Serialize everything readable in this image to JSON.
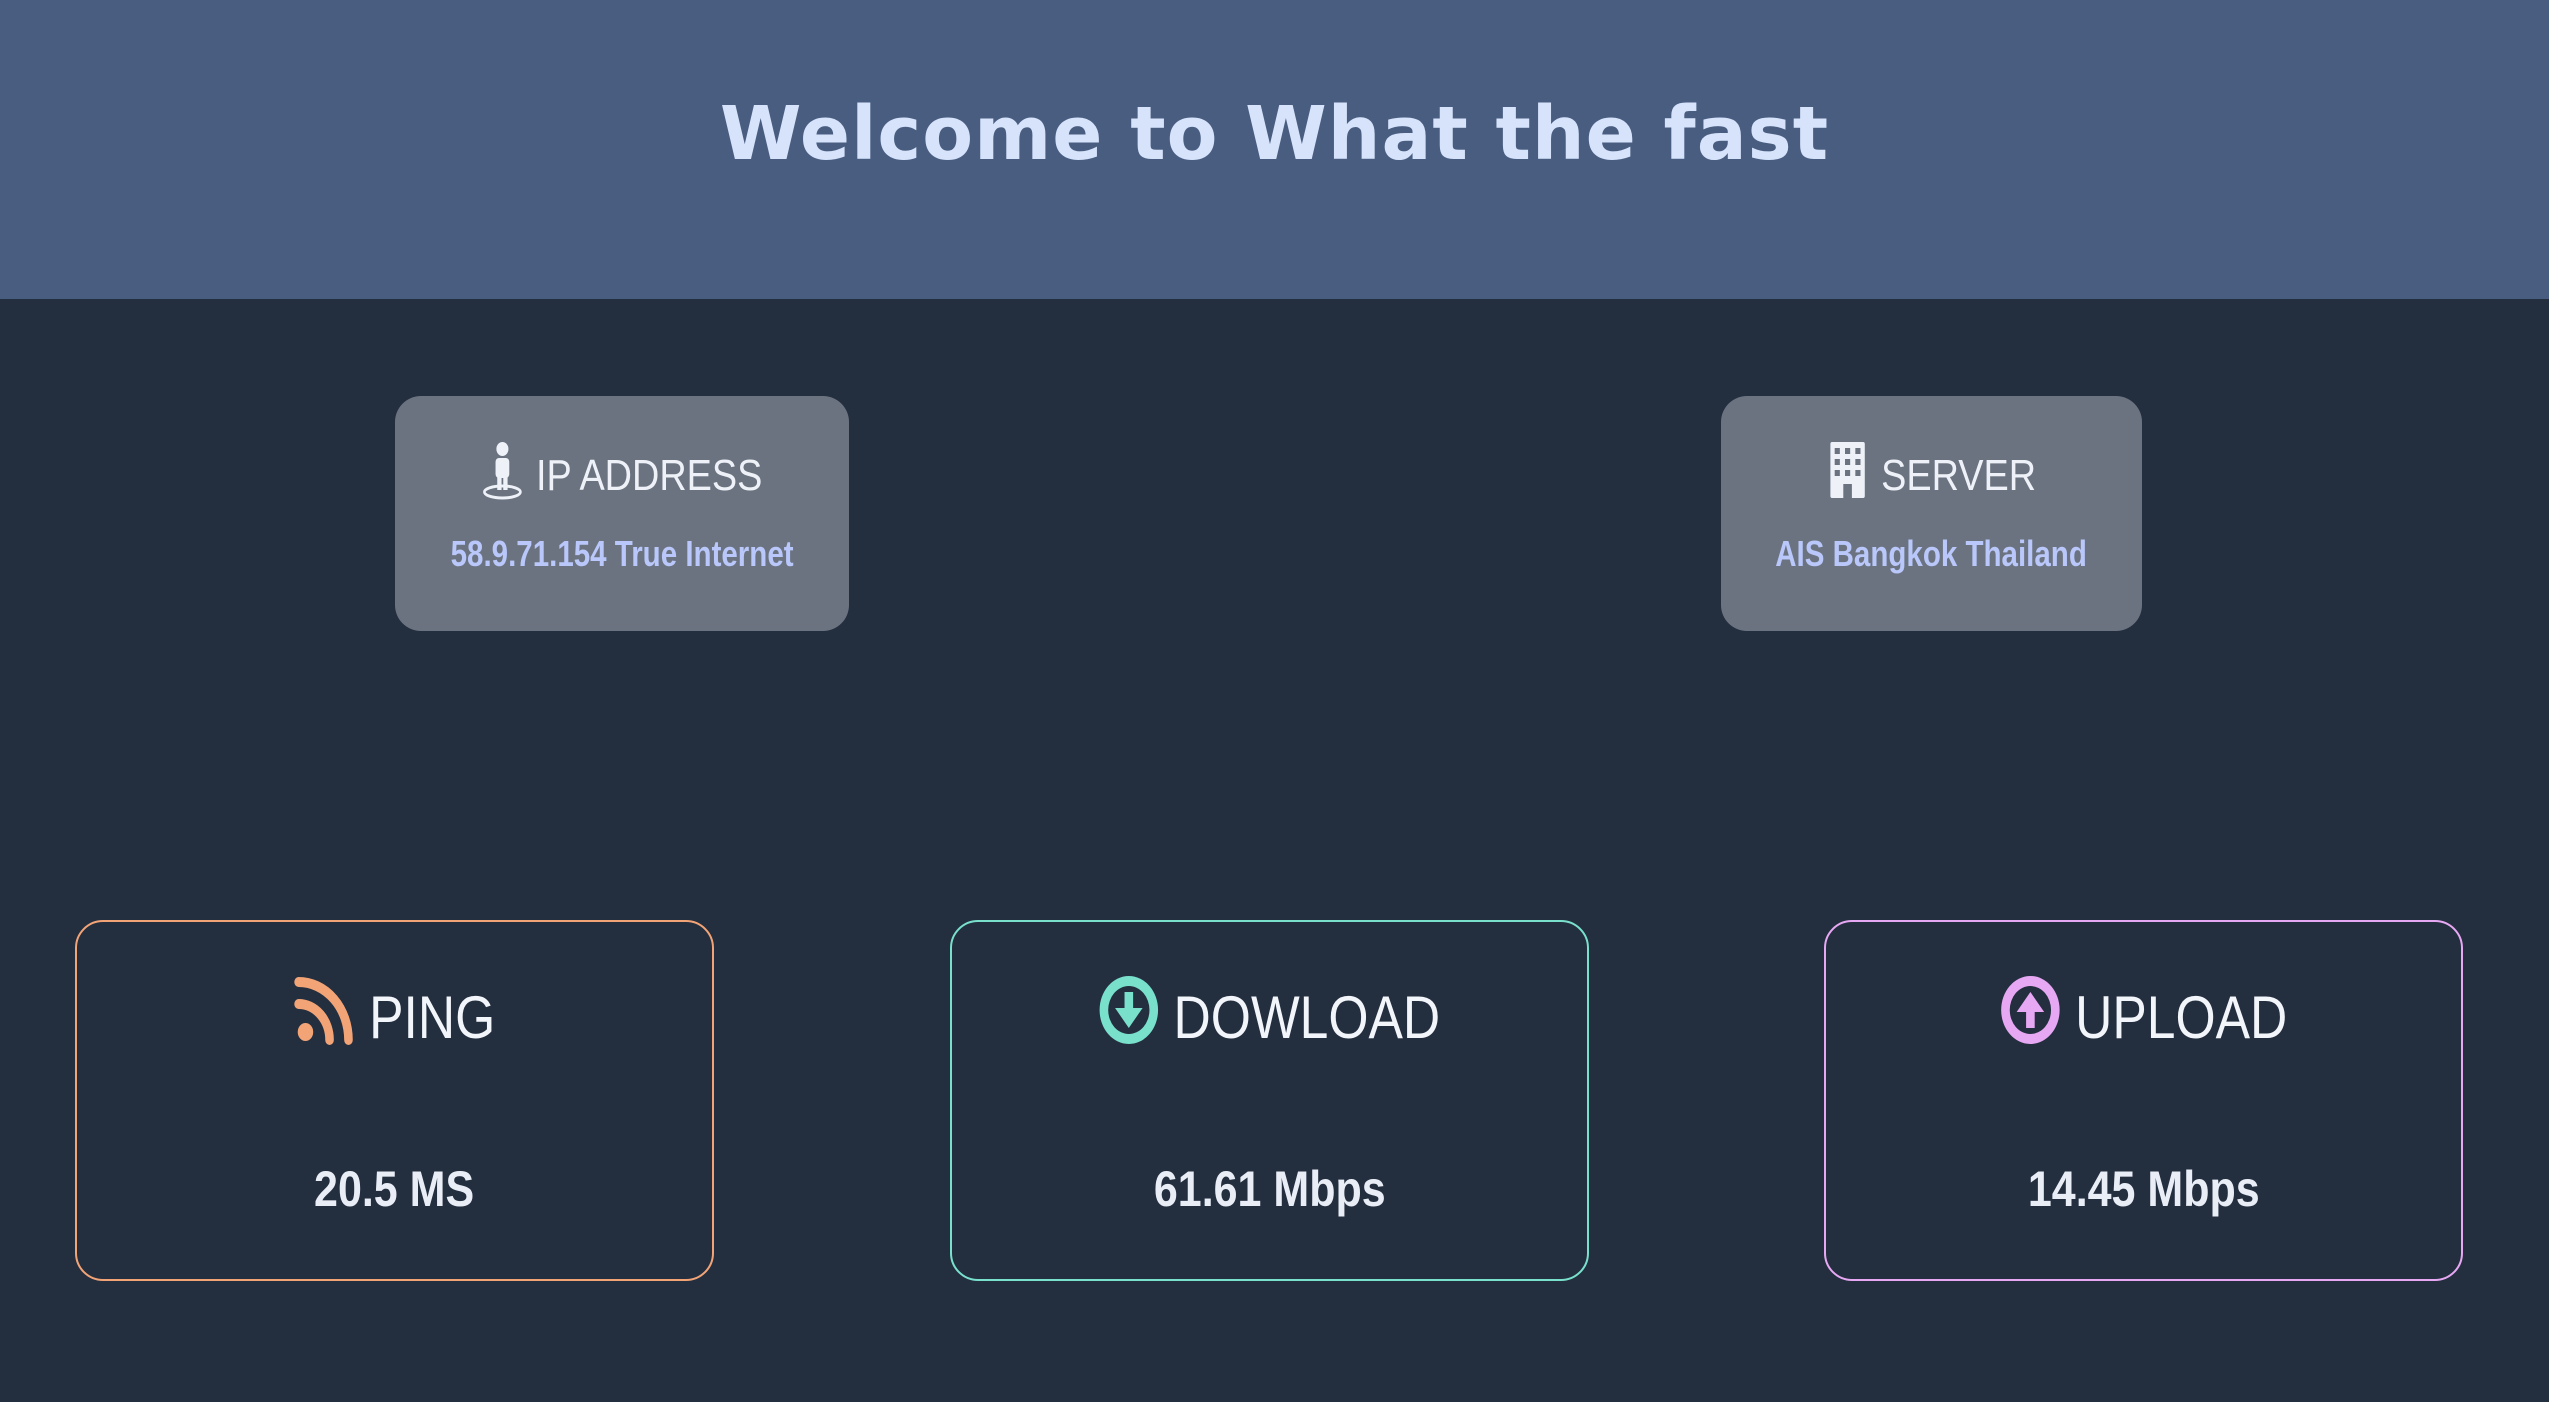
{
  "header": {
    "title": "Welcome to What the fast"
  },
  "info": {
    "ip": {
      "label": "IP ADDRESS",
      "value": "58.9.71.154 True Internet",
      "icon": "street-view-icon"
    },
    "server": {
      "label": "SERVER",
      "value": "AIS Bangkok Thailand",
      "icon": "building-icon"
    }
  },
  "metrics": {
    "ping": {
      "label": "PING",
      "value": "20.5 MS",
      "icon": "rss-icon",
      "color": "#f2a477"
    },
    "download": {
      "label": "DOWLOAD",
      "value": "61.61 Mbps",
      "icon": "arrow-circle-down-icon",
      "color": "#79e0cc"
    },
    "upload": {
      "label": "UPLOAD",
      "value": "14.45 Mbps",
      "icon": "arrow-circle-up-icon",
      "color": "#e7a8f3"
    }
  },
  "colors": {
    "background": "#232e3f",
    "header": "#495d80",
    "header_text": "#d6e3fb",
    "info_card": "#6b7380",
    "info_value": "#b9c7fa"
  }
}
